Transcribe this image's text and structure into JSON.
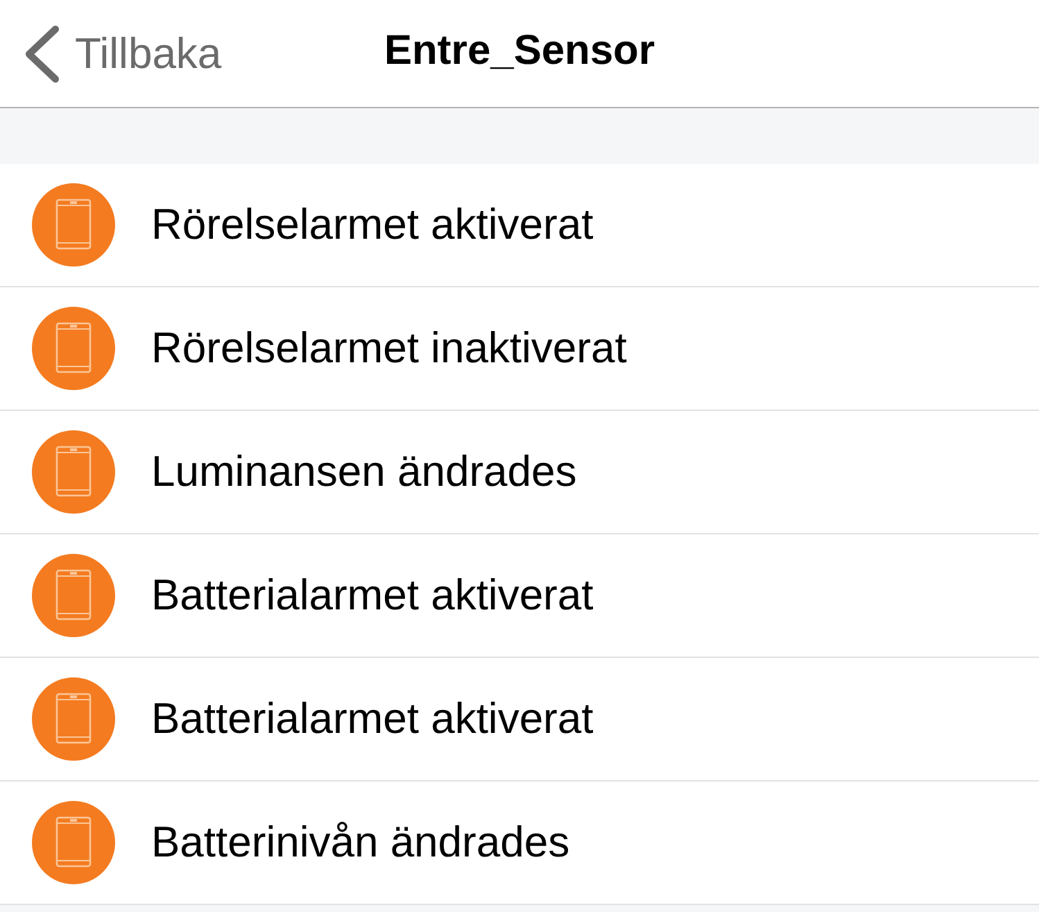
{
  "nav_bar": {
    "back_label": "Tillbaka",
    "title": "Entre_Sensor"
  },
  "events": [
    {
      "label": "Rörelselarmet aktiverat"
    },
    {
      "label": "Rörelselarmet inaktiverat"
    },
    {
      "label": "Luminansen ändrades"
    },
    {
      "label": "Batterialarmet aktiverat"
    },
    {
      "label": "Batterialarmet aktiverat"
    },
    {
      "label": "Batterinivån ändrades"
    }
  ]
}
